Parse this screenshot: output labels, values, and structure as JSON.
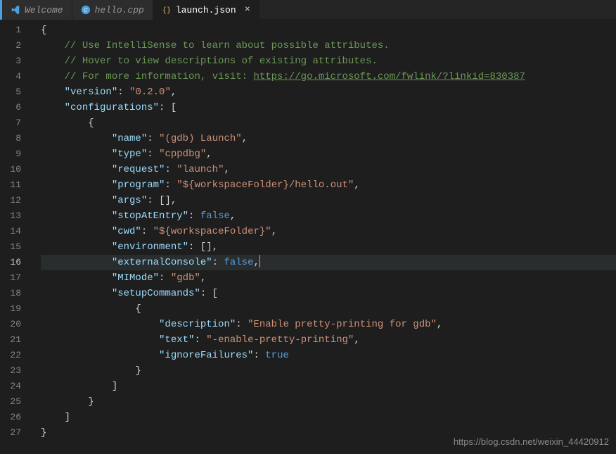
{
  "tabs": [
    {
      "label": "Welcome",
      "icon": "welcome"
    },
    {
      "label": "hello.cpp",
      "icon": "cpp"
    },
    {
      "label": "launch.json",
      "icon": "json",
      "active": true,
      "close": "×"
    }
  ],
  "gutter": {
    "lines": [
      "1",
      "2",
      "3",
      "4",
      "5",
      "6",
      "7",
      "8",
      "9",
      "10",
      "11",
      "12",
      "13",
      "14",
      "15",
      "16",
      "17",
      "18",
      "19",
      "20",
      "21",
      "22",
      "23",
      "24",
      "25",
      "26",
      "27"
    ],
    "activeLine": "16"
  },
  "code": {
    "l1_open": "{",
    "l2_comment": "// Use IntelliSense to learn about possible attributes.",
    "l3_comment": "// Hover to view descriptions of existing attributes.",
    "l4_comment_pre": "// For more information, visit: ",
    "l4_link": "https://go.microsoft.com/fwlink/?linkid=830387",
    "l5_key": "\"version\"",
    "l5_val": "\"0.2.0\"",
    "l6_key": "\"configurations\"",
    "l7_open": "{",
    "l8_key": "\"name\"",
    "l8_val": "\"(gdb) Launch\"",
    "l9_key": "\"type\"",
    "l9_val": "\"cppdbg\"",
    "l10_key": "\"request\"",
    "l10_val": "\"launch\"",
    "l11_key": "\"program\"",
    "l11_val": "\"${workspaceFolder}/hello.out\"",
    "l12_key": "\"args\"",
    "l13_key": "\"stopAtEntry\"",
    "l13_val": "false",
    "l14_key": "\"cwd\"",
    "l14_val": "\"${workspaceFolder}\"",
    "l15_key": "\"environment\"",
    "l16_key": "\"externalConsole\"",
    "l16_val": "false",
    "l17_key": "\"MIMode\"",
    "l17_val": "\"gdb\"",
    "l18_key": "\"setupCommands\"",
    "l19_open": "{",
    "l20_key": "\"description\"",
    "l20_val": "\"Enable pretty-printing for gdb\"",
    "l21_key": "\"text\"",
    "l21_val": "\"-enable-pretty-printing\"",
    "l22_key": "\"ignoreFailures\"",
    "l22_val": "true",
    "l23_close": "}",
    "l24_close": "]",
    "l25_close": "}",
    "l26_close": "]",
    "l27_close": "}",
    "colon": ": ",
    "comma": ",",
    "lbracket": "[",
    "rbracket": "]",
    "empty_arr": "[]"
  },
  "watermark": "https://blog.csdn.net/weixin_44420912"
}
